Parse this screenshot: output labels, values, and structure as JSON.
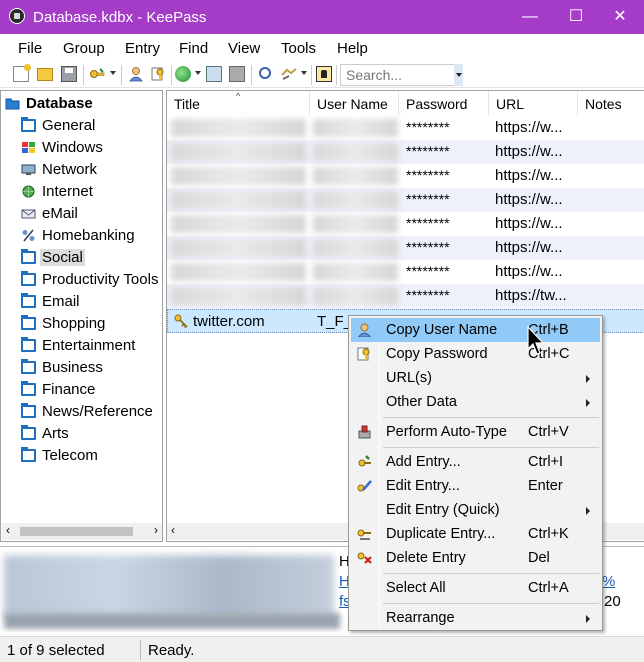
{
  "window": {
    "title": "Database.kdbx - KeePass",
    "controls": {
      "minimize": "—",
      "maximize": "☐",
      "close": "✕"
    }
  },
  "menu": [
    "File",
    "Group",
    "Entry",
    "Find",
    "View",
    "Tools",
    "Help"
  ],
  "toolbar": {
    "search_placeholder": "Search..."
  },
  "tree": {
    "root": "Database",
    "groups": [
      "General",
      "Windows",
      "Network",
      "Internet",
      "eMail",
      "Homebanking",
      "Social",
      "Productivity Tools",
      "Email",
      "Shopping",
      "Entertainment",
      "Business",
      "Finance",
      "News/Reference",
      "Arts",
      "Telecom"
    ],
    "selected": "Social"
  },
  "entries": {
    "columns": [
      "Title",
      "User Name",
      "Password",
      "URL",
      "Notes"
    ],
    "rows": [
      {
        "password": "********",
        "url": "https://w..."
      },
      {
        "password": "********",
        "url": "https://w..."
      },
      {
        "password": "********",
        "url": "https://w..."
      },
      {
        "password": "********",
        "url": "https://w..."
      },
      {
        "password": "********",
        "url": "https://w..."
      },
      {
        "password": "********",
        "url": "https://w..."
      },
      {
        "password": "********",
        "url": "https://w..."
      },
      {
        "password": "********",
        "url": "https://tw..."
      }
    ],
    "selected_row": {
      "title": "twitter.com",
      "user": "T_F_H"
    }
  },
  "details": {
    "frag_h1": "H",
    "frag_h2": "H",
    "frag_fs": "fs",
    "frag_pct": "%",
    "frag_20": "20"
  },
  "context_menu": {
    "items": [
      {
        "label": "Copy User Name",
        "shortcut": "Ctrl+B"
      },
      {
        "label": "Copy Password",
        "shortcut": "Ctrl+C"
      },
      {
        "label": "URL(s)",
        "shortcut": ""
      },
      {
        "label": "Other Data",
        "shortcut": ""
      },
      {
        "label": "Perform Auto-Type",
        "shortcut": "Ctrl+V"
      },
      {
        "label": "Add Entry...",
        "shortcut": "Ctrl+I"
      },
      {
        "label": "Edit Entry...",
        "shortcut": "Enter"
      },
      {
        "label": "Edit Entry (Quick)",
        "shortcut": ""
      },
      {
        "label": "Duplicate Entry...",
        "shortcut": "Ctrl+K"
      },
      {
        "label": "Delete Entry",
        "shortcut": "Del"
      },
      {
        "label": "Select All",
        "shortcut": "Ctrl+A"
      },
      {
        "label": "Rearrange",
        "shortcut": ""
      }
    ]
  },
  "status": {
    "selection": "1 of 9 selected",
    "state": "Ready."
  },
  "colors": {
    "titlebar": "#a53cc8",
    "highlight": "#91c9f7",
    "folder": "#1f6fc0",
    "row_alt": "#eef0fb"
  }
}
